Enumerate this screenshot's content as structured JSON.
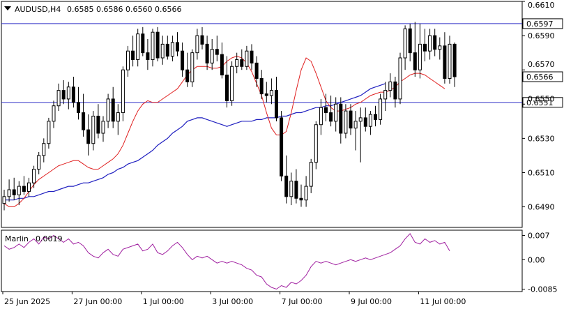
{
  "chart_data": {
    "type": "candlestick",
    "symbol": "AUDUSD,H4",
    "ohlc_header": [
      "0.6585",
      "0.6586",
      "0.6560",
      "0.6566"
    ],
    "price_axis": {
      "ylim": [
        0.6478,
        0.661
      ],
      "ticks": [
        "0.6610",
        "0.6590",
        "0.6570",
        "0.6550",
        "0.6530",
        "0.6510",
        "0.6490"
      ],
      "tick_values": [
        0.661,
        0.659,
        0.657,
        0.655,
        0.653,
        0.651,
        0.649
      ]
    },
    "time_axis": {
      "labels": [
        "25 Jun 2025",
        "27 Jun 00:00",
        "1 Jul 00:00",
        "3 Jul 00:00",
        "7 Jul 00:00",
        "9 Jul 00:00",
        "11 Jul 00:00"
      ],
      "label_bar_index": [
        0,
        14,
        28,
        42,
        56,
        70,
        84
      ]
    },
    "horizontal_lines": [
      {
        "value": 0.6597,
        "label": "0.6597",
        "color": "#3030c8"
      },
      {
        "value": 0.6551,
        "label": "0.6551",
        "color": "#3030c8"
      }
    ],
    "current_price": {
      "value": 0.6566,
      "label": "0.6566"
    },
    "candles": [
      [
        0.6492,
        0.65,
        0.6488,
        0.6496
      ],
      [
        0.6496,
        0.6506,
        0.6493,
        0.65
      ],
      [
        0.65,
        0.6507,
        0.6494,
        0.6497
      ],
      [
        0.6497,
        0.6505,
        0.6491,
        0.6502
      ],
      [
        0.6502,
        0.6508,
        0.6497,
        0.6499
      ],
      [
        0.6499,
        0.6507,
        0.6496,
        0.6504
      ],
      [
        0.6504,
        0.6514,
        0.6501,
        0.6512
      ],
      [
        0.6512,
        0.6522,
        0.6509,
        0.652
      ],
      [
        0.652,
        0.653,
        0.6516,
        0.6527
      ],
      [
        0.6527,
        0.6542,
        0.6524,
        0.654
      ],
      [
        0.654,
        0.6552,
        0.6536,
        0.6549
      ],
      [
        0.6549,
        0.6562,
        0.6546,
        0.6558
      ],
      [
        0.6558,
        0.6564,
        0.655,
        0.6553
      ],
      [
        0.6553,
        0.6563,
        0.6547,
        0.656
      ],
      [
        0.656,
        0.6566,
        0.6548,
        0.6551
      ],
      [
        0.6551,
        0.656,
        0.6541,
        0.6545
      ],
      [
        0.6545,
        0.6556,
        0.6531,
        0.6535
      ],
      [
        0.6535,
        0.6544,
        0.652,
        0.6527
      ],
      [
        0.6527,
        0.6546,
        0.6523,
        0.6543
      ],
      [
        0.6543,
        0.655,
        0.653,
        0.6533
      ],
      [
        0.6533,
        0.6543,
        0.6528,
        0.654
      ],
      [
        0.654,
        0.6556,
        0.6536,
        0.6553
      ],
      [
        0.6553,
        0.656,
        0.6536,
        0.654
      ],
      [
        0.654,
        0.655,
        0.6532,
        0.6545
      ],
      [
        0.6545,
        0.6572,
        0.654,
        0.657
      ],
      [
        0.657,
        0.6584,
        0.6566,
        0.6581
      ],
      [
        0.6581,
        0.659,
        0.6572,
        0.6576
      ],
      [
        0.6576,
        0.6594,
        0.6572,
        0.6591
      ],
      [
        0.6591,
        0.6595,
        0.6578,
        0.658
      ],
      [
        0.658,
        0.6588,
        0.657,
        0.6576
      ],
      [
        0.6576,
        0.6594,
        0.6572,
        0.6592
      ],
      [
        0.6592,
        0.6595,
        0.6575,
        0.6577
      ],
      [
        0.6577,
        0.659,
        0.6573,
        0.6585
      ],
      [
        0.6585,
        0.659,
        0.6576,
        0.6578
      ],
      [
        0.6578,
        0.659,
        0.6575,
        0.6586
      ],
      [
        0.6586,
        0.6592,
        0.6578,
        0.6581
      ],
      [
        0.6581,
        0.6586,
        0.6566,
        0.657
      ],
      [
        0.657,
        0.658,
        0.656,
        0.6563
      ],
      [
        0.6563,
        0.6582,
        0.656,
        0.658
      ],
      [
        0.658,
        0.6594,
        0.6576,
        0.659
      ],
      [
        0.659,
        0.6595,
        0.6582,
        0.6585
      ],
      [
        0.6585,
        0.659,
        0.657,
        0.6574
      ],
      [
        0.6574,
        0.6588,
        0.657,
        0.6582
      ],
      [
        0.6582,
        0.659,
        0.6575,
        0.6579
      ],
      [
        0.6579,
        0.6586,
        0.6565,
        0.6567
      ],
      [
        0.6567,
        0.6578,
        0.6548,
        0.6552
      ],
      [
        0.6552,
        0.6575,
        0.6549,
        0.6572
      ],
      [
        0.6572,
        0.658,
        0.6568,
        0.6576
      ],
      [
        0.6576,
        0.6582,
        0.657,
        0.6572
      ],
      [
        0.6572,
        0.6584,
        0.657,
        0.6581
      ],
      [
        0.6581,
        0.6585,
        0.657,
        0.6574
      ],
      [
        0.6574,
        0.6578,
        0.656,
        0.6565
      ],
      [
        0.6565,
        0.657,
        0.6553,
        0.6556
      ],
      [
        0.6556,
        0.6563,
        0.6551,
        0.6555
      ],
      [
        0.6555,
        0.6565,
        0.655,
        0.6558
      ],
      [
        0.6558,
        0.6566,
        0.654,
        0.6542
      ],
      [
        0.6542,
        0.6546,
        0.6505,
        0.6508
      ],
      [
        0.6508,
        0.652,
        0.6492,
        0.6496
      ],
      [
        0.6496,
        0.651,
        0.6491,
        0.6505
      ],
      [
        0.6505,
        0.6512,
        0.6492,
        0.6495
      ],
      [
        0.6495,
        0.6503,
        0.649,
        0.6494
      ],
      [
        0.6494,
        0.6508,
        0.649,
        0.6502
      ],
      [
        0.6502,
        0.6518,
        0.6498,
        0.6516
      ],
      [
        0.6516,
        0.654,
        0.6512,
        0.6538
      ],
      [
        0.6538,
        0.6553,
        0.6532,
        0.6548
      ],
      [
        0.6548,
        0.6556,
        0.654,
        0.6545
      ],
      [
        0.6545,
        0.6555,
        0.6537,
        0.654
      ],
      [
        0.654,
        0.6554,
        0.6534,
        0.655
      ],
      [
        0.655,
        0.6554,
        0.6527,
        0.6533
      ],
      [
        0.6533,
        0.655,
        0.653,
        0.6546
      ],
      [
        0.6546,
        0.655,
        0.6532,
        0.6536
      ],
      [
        0.6536,
        0.6546,
        0.6523,
        0.654
      ],
      [
        0.654,
        0.6548,
        0.6516,
        0.6542
      ],
      [
        0.6542,
        0.6548,
        0.6534,
        0.6537
      ],
      [
        0.6537,
        0.6546,
        0.6532,
        0.6544
      ],
      [
        0.6544,
        0.6549,
        0.6537,
        0.6541
      ],
      [
        0.6541,
        0.6556,
        0.6538,
        0.6553
      ],
      [
        0.6553,
        0.6563,
        0.6546,
        0.6558
      ],
      [
        0.6558,
        0.6568,
        0.6554,
        0.6563
      ],
      [
        0.6563,
        0.6566,
        0.6548,
        0.6553
      ],
      [
        0.6553,
        0.658,
        0.655,
        0.6577
      ],
      [
        0.6577,
        0.6596,
        0.657,
        0.6594
      ],
      [
        0.6594,
        0.6597,
        0.6575,
        0.658
      ],
      [
        0.658,
        0.6598,
        0.6566,
        0.657
      ],
      [
        0.657,
        0.6597,
        0.6565,
        0.6585
      ],
      [
        0.6585,
        0.6594,
        0.6575,
        0.6581
      ],
      [
        0.6581,
        0.6594,
        0.6576,
        0.659
      ],
      [
        0.659,
        0.6594,
        0.6578,
        0.6582
      ],
      [
        0.6582,
        0.6589,
        0.6576,
        0.6584
      ],
      [
        0.6584,
        0.6592,
        0.6562,
        0.6565
      ],
      [
        0.6565,
        0.659,
        0.6562,
        0.6585
      ],
      [
        0.6585,
        0.6586,
        0.656,
        0.6566
      ]
    ],
    "ma_fast": {
      "color": "#e02020",
      "values": [
        0.6492,
        0.649,
        0.649,
        0.6492,
        0.6495,
        0.6499,
        0.6503,
        0.6506,
        0.6508,
        0.651,
        0.6512,
        0.6514,
        0.6515,
        0.6516,
        0.6517,
        0.6517,
        0.6515,
        0.6513,
        0.6512,
        0.6512,
        0.6514,
        0.6516,
        0.6518,
        0.6521,
        0.6526,
        0.6533,
        0.654,
        0.6546,
        0.655,
        0.6552,
        0.6551,
        0.6551,
        0.6553,
        0.6555,
        0.6557,
        0.6559,
        0.6563,
        0.6567,
        0.657,
        0.6572,
        0.6572,
        0.6572,
        0.6571,
        0.6571,
        0.6572,
        0.6575,
        0.6577,
        0.6578,
        0.6577,
        0.6574,
        0.6569,
        0.6562,
        0.6555,
        0.6545,
        0.6536,
        0.6532,
        0.6532,
        0.6534,
        0.6545,
        0.6558,
        0.657,
        0.6577,
        0.6575,
        0.6568,
        0.656,
        0.6552,
        0.6548,
        0.6546,
        0.6546,
        0.6547,
        0.6548,
        0.655,
        0.6551,
        0.6553,
        0.6555,
        0.6556,
        0.6557,
        0.6557,
        0.6558,
        0.656,
        0.6563,
        0.6565,
        0.6567,
        0.6568,
        0.6568,
        0.6567,
        0.6565,
        0.6563,
        0.6561,
        0.6559
      ]
    },
    "ma_slow": {
      "color": "#2020c0",
      "values": [
        0.6494,
        0.6494,
        0.6494,
        0.6495,
        0.6495,
        0.6496,
        0.6496,
        0.6497,
        0.6498,
        0.6499,
        0.6499,
        0.65,
        0.6501,
        0.6502,
        0.6502,
        0.6503,
        0.6504,
        0.6504,
        0.6505,
        0.6506,
        0.6507,
        0.6509,
        0.651,
        0.6512,
        0.6513,
        0.6515,
        0.6516,
        0.6517,
        0.6519,
        0.6521,
        0.6523,
        0.6526,
        0.6528,
        0.653,
        0.6533,
        0.6535,
        0.6537,
        0.654,
        0.6541,
        0.6542,
        0.6542,
        0.6541,
        0.654,
        0.6539,
        0.6538,
        0.6537,
        0.6538,
        0.6539,
        0.654,
        0.654,
        0.654,
        0.6541,
        0.6541,
        0.6542,
        0.6542,
        0.6542,
        0.6543,
        0.6543,
        0.6544,
        0.6545,
        0.6545,
        0.6546,
        0.6547,
        0.6548,
        0.6548,
        0.6549,
        0.6549,
        0.655,
        0.6551,
        0.6552,
        0.6553,
        0.6554,
        0.6555,
        0.6557,
        0.6559,
        0.656,
        0.6561,
        0.6562
      ]
    },
    "indicator": {
      "name": "Marlin",
      "value_label": "0.0019",
      "color": "#a020a0",
      "ylim": [
        -0.0092,
        0.0085
      ],
      "ticks": [
        "0.007",
        "0.00",
        "-0.0085"
      ],
      "tick_values": [
        0.007,
        0.0,
        -0.0085
      ],
      "values": [
        0.004,
        0.003,
        0.0035,
        0.0045,
        0.0035,
        0.005,
        0.006,
        0.0045,
        0.0065,
        0.006,
        0.007,
        0.006,
        0.005,
        0.006,
        0.0045,
        0.005,
        0.004,
        0.002,
        0.001,
        0.0005,
        0.002,
        0.003,
        0.0015,
        0.001,
        0.003,
        0.0035,
        0.004,
        0.0045,
        0.0025,
        0.003,
        0.0045,
        0.002,
        0.0015,
        0.0025,
        0.004,
        0.005,
        0.0035,
        0.0015,
        0.0,
        0.001,
        0.0005,
        0.001,
        0.0,
        -0.001,
        -0.0005,
        -0.001,
        -0.0005,
        -0.001,
        -0.0015,
        -0.0025,
        -0.003,
        -0.0045,
        -0.005,
        -0.007,
        -0.008,
        -0.0085,
        -0.0075,
        -0.008,
        -0.0065,
        -0.007,
        -0.006,
        -0.0045,
        -0.002,
        -0.0005,
        -0.001,
        -0.0005,
        -0.001,
        -0.0015,
        -0.001,
        -0.0005,
        0.0,
        -0.0005,
        0.0,
        0.0005,
        0.0,
        0.0005,
        0.001,
        0.0015,
        0.002,
        0.003,
        0.004,
        0.006,
        0.0075,
        0.005,
        0.0045,
        0.006,
        0.005,
        0.0055,
        0.0045,
        0.005,
        0.0025
      ]
    }
  }
}
